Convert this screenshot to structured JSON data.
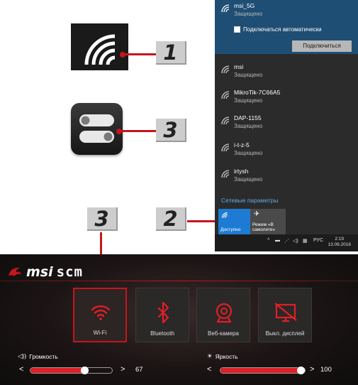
{
  "callouts": [
    "1",
    "2",
    "3",
    "3"
  ],
  "network_flyout": {
    "selected": {
      "name": "msi_5G",
      "status": "Защищено",
      "auto_connect_label": "Подключаться автоматически",
      "connect_label": "Подключиться"
    },
    "networks": [
      {
        "name": "msi",
        "status": "Защищено"
      },
      {
        "name": "MikroTik-7C66A5",
        "status": "Защищено"
      },
      {
        "name": "DAP-1155",
        "status": "Защищено"
      },
      {
        "name": "i-t-z-5",
        "status": "Защищено"
      },
      {
        "name": "irtysh",
        "status": "Защищено"
      }
    ],
    "settings_link": "Сетевые параметры",
    "tile_wifi_label": "Доступно",
    "tile_airplane_label": "Режим «В самолете»",
    "taskbar": {
      "lang": "РУС",
      "time": "2:19",
      "date": "13.09.2016"
    }
  },
  "scm": {
    "brand": "msi",
    "app": "scm",
    "tiles": [
      {
        "label": "Wi-Fi",
        "icon": "wifi-icon",
        "active": true
      },
      {
        "label": "Bluetooth",
        "icon": "bluetooth-icon",
        "active": false
      },
      {
        "label": "Веб-камера",
        "icon": "webcam-icon",
        "active": false
      },
      {
        "label": "Выкл. дисплей",
        "icon": "display-off-icon",
        "active": false
      }
    ],
    "volume": {
      "label": "Громкость",
      "value": "67",
      "level": 0.67
    },
    "brightness": {
      "label": "Яркость",
      "value": "100",
      "level": 1.0
    },
    "accent": "#c4161c"
  }
}
